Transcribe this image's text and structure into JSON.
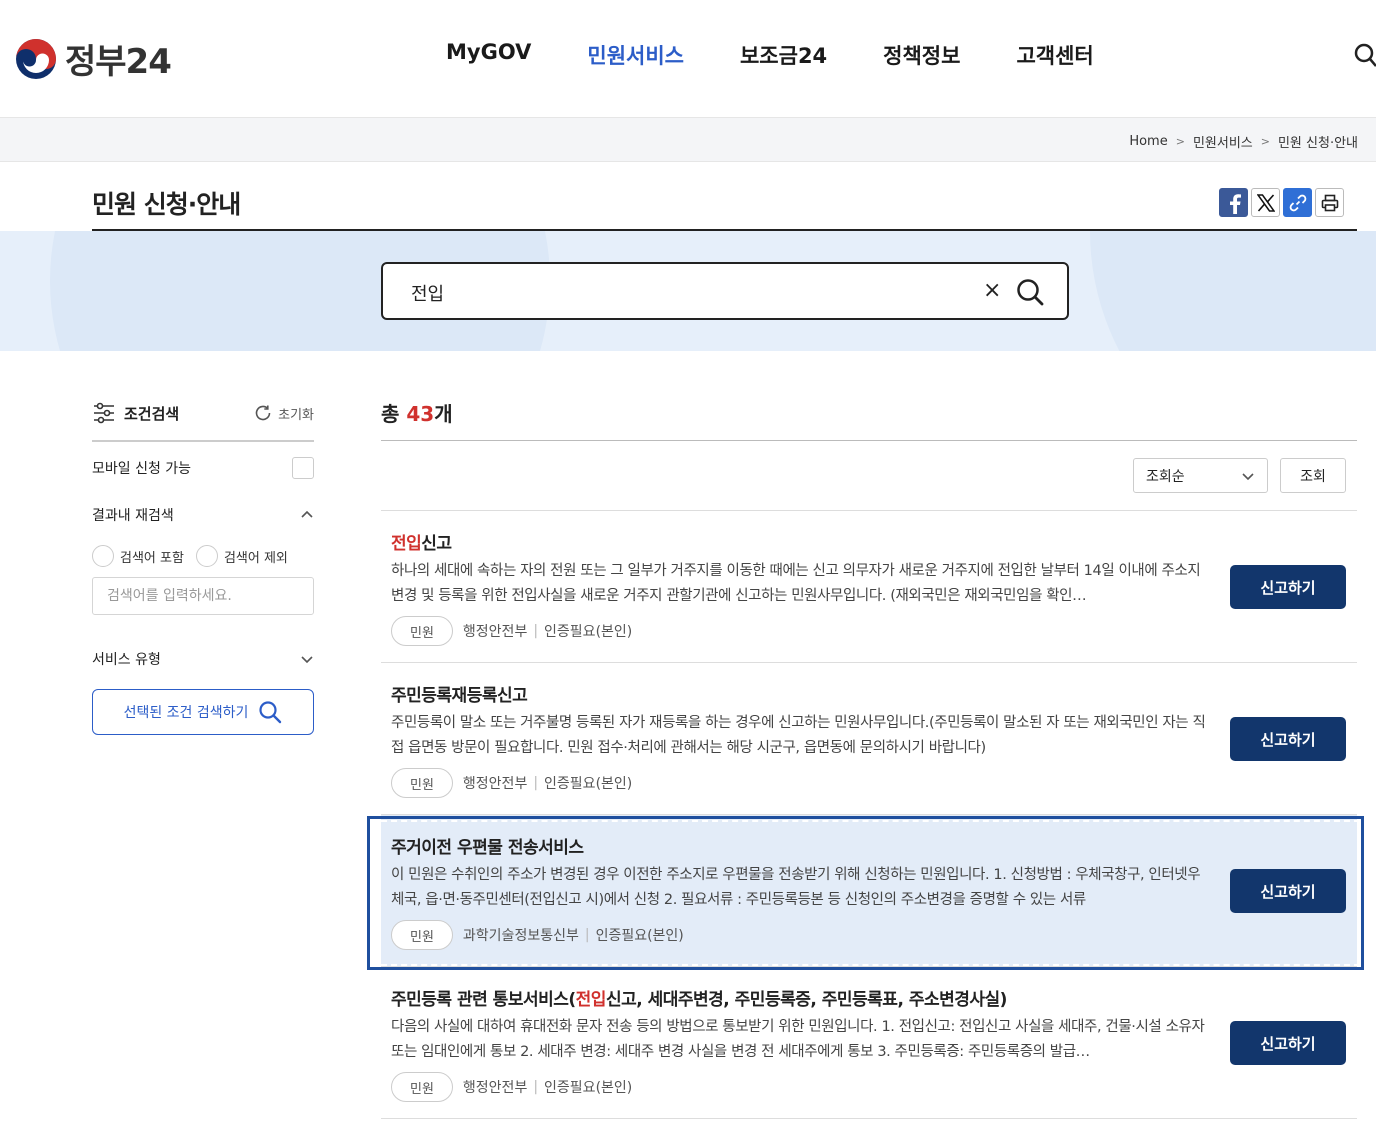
{
  "header": {
    "logo_text": "정부24",
    "nav": [
      "MyGOV",
      "민원서비스",
      "보조금24",
      "정책정보",
      "고객센터"
    ],
    "active_nav_index": 1
  },
  "breadcrumb": [
    "Home",
    "민원서비스",
    "민원 신청·안내"
  ],
  "page": {
    "title": "민원 신청·안내"
  },
  "search": {
    "value": "전입",
    "clear_label": "×"
  },
  "sidebar": {
    "title": "조건검색",
    "reset_label": "초기화",
    "mobile_label": "모바일 신청 가능",
    "research_label": "결과내 재검색",
    "include_label": "검색어 포함",
    "exclude_label": "검색어 제외",
    "input_placeholder": "검색어를 입력하세요.",
    "service_type_label": "서비스 유형",
    "search_button_label": "선택된 조건 검색하기"
  },
  "results": {
    "total_prefix": "총 ",
    "total_count": "43",
    "total_suffix": "개",
    "sort_value": "조회순",
    "query_label": "조회",
    "items": [
      {
        "title_hl": "전입",
        "title_rest": "신고",
        "title_tail": "",
        "desc": "하나의 세대에 속하는 자의 전원 또는 그 일부가 거주지를 이동한 때에는 신고 의무자가 새로운 거주지에 전입한 날부터 14일 이내에 주소지변경 및 등록을 위한 전입사실을 새로운 거주지 관할기관에 신고하는 민원사무입니다. (재외국민은 재외국민임을 확인…",
        "tag": "민원",
        "agency": "행정안전부",
        "auth": "인증필요(본인)",
        "button": "신고하기"
      },
      {
        "title_hl": "",
        "title_rest": "주민등록재등록신고",
        "title_tail": "",
        "desc": "주민등록이 말소 또는 거주불명 등록된 자가 재등록을 하는 경우에 신고하는 민원사무입니다.(주민등록이 말소된 자 또는 재외국민인 자는 직접 읍면동 방문이 필요합니다. 민원 접수·처리에 관해서는 해당 시군구, 읍면동에 문의하시기 바랍니다)",
        "tag": "민원",
        "agency": "행정안전부",
        "auth": "인증필요(본인)",
        "button": "신고하기"
      },
      {
        "title_hl": "",
        "title_rest": "주거이전 우편물 전송서비스",
        "title_tail": "",
        "desc": "이 민원은 수취인의 주소가 변경된 경우 이전한 주소지로 우편물을 전송받기 위해 신청하는 민원입니다. 1. 신청방법 : 우체국창구, 인터넷우체국, 읍·면·동주민센터(전입신고 시)에서 신청 2. 필요서류 : 주민등록등본 등 신청인의 주소변경을 증명할 수 있는 서류",
        "tag": "민원",
        "agency": "과학기술정보통신부",
        "auth": "인증필요(본인)",
        "button": "신고하기"
      },
      {
        "title_hl": "전입",
        "title_rest": "주민등록 관련 통보서비스(",
        "title_tail": "신고, 세대주변경, 주민등록증, 주민등록표, 주소변경사실)",
        "desc": "다음의 사실에 대하여 휴대전화 문자 전송 등의 방법으로 통보받기 위한 민원입니다. 1. 전입신고: 전입신고 사실을 세대주, 건물·시설 소유자 또는 임대인에게 통보 2. 세대주 변경: 세대주 변경 사실을 변경 전 세대주에게 통보 3. 주민등록증: 주민등록증의 발급…",
        "tag": "민원",
        "agency": "행정안전부",
        "auth": "인증필요(본인)",
        "button": "신고하기"
      }
    ]
  },
  "colors": {
    "brand_blue": "#2c5dc8",
    "highlight_red": "#d0312d",
    "button_navy": "#12366c",
    "focus_bg": "#e3ecf8"
  }
}
